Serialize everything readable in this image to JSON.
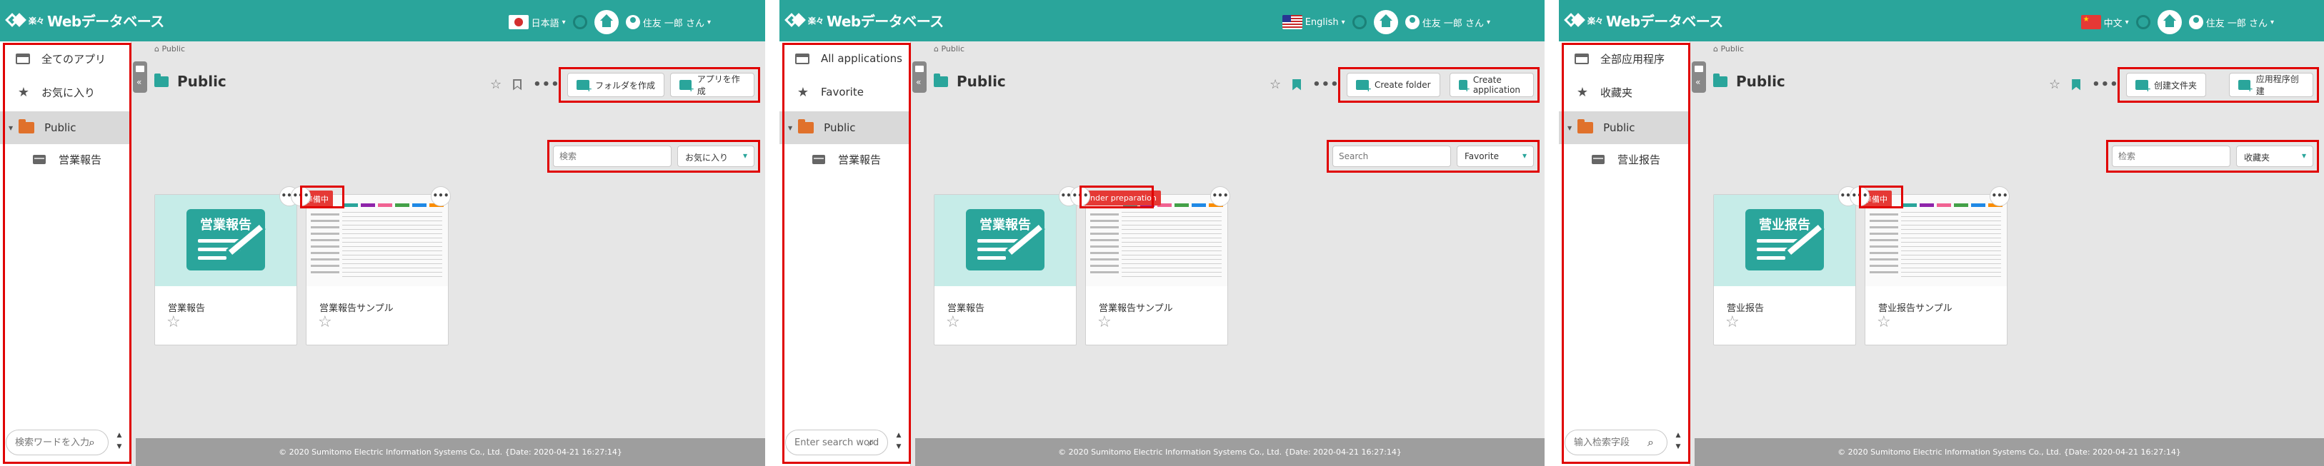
{
  "app": {
    "logo_small": "楽々",
    "logo_text": "Webデータベース",
    "user_name": "住友 一郎 さん",
    "footer": "© 2020 Sumitomo Electric Information Systems Co., Ltd. {Date: 2020-04-21 16:27:14}",
    "accent_color": "#2aa59b",
    "badge_color": "#e53935"
  },
  "icons": {
    "home": "home-icon",
    "user": "user-icon",
    "star": "star-icon",
    "folder": "folder-icon",
    "bookmark": "bookmark-icon",
    "search": "search-icon"
  },
  "panels": [
    {
      "language": "日本語",
      "flag": "jp",
      "sidebar": {
        "all_apps": "全てのアプリ",
        "favorite": "お気に入り",
        "public": "Public",
        "sub_item": "営業報告",
        "search_placeholder": "検索ワードを入力"
      },
      "breadcrumb": "Public",
      "title": "Public",
      "create_folder": "フォルダを作成",
      "create_app": "アプリを作成",
      "search_placeholder": "検索",
      "filter_value": "お気に入り",
      "cards": [
        {
          "label": "営業報告",
          "thumb_title": "営業報告"
        },
        {
          "label": "営業報告サンプル",
          "badge": "準備中"
        }
      ]
    },
    {
      "language": "English",
      "flag": "us",
      "sidebar": {
        "all_apps": "All applications",
        "favorite": "Favorite",
        "public": "Public",
        "sub_item": "営業報告",
        "search_placeholder": "Enter search word"
      },
      "breadcrumb": "Public",
      "title": "Public",
      "create_folder": "Create folder",
      "create_app": "Create application",
      "search_placeholder": "Search",
      "filter_value": "Favorite",
      "cards": [
        {
          "label": "営業報告",
          "thumb_title": "営業報告"
        },
        {
          "label": "営業報告サンプル",
          "badge": "Under preparation"
        }
      ]
    },
    {
      "language": "中文",
      "flag": "cn",
      "sidebar": {
        "all_apps": "全部应用程序",
        "favorite": "收藏夹",
        "public": "Public",
        "sub_item": "营业报告",
        "search_placeholder": "输入检索字段"
      },
      "breadcrumb": "Public",
      "title": "Public",
      "create_folder": "创建文件夹",
      "create_app": "应用程序创建",
      "search_placeholder": "检索",
      "filter_value": "收藏夹",
      "cards": [
        {
          "label": "营业报告",
          "thumb_title": "营业报告"
        },
        {
          "label": "营业报告サンプル",
          "badge": "準備中"
        }
      ]
    }
  ]
}
